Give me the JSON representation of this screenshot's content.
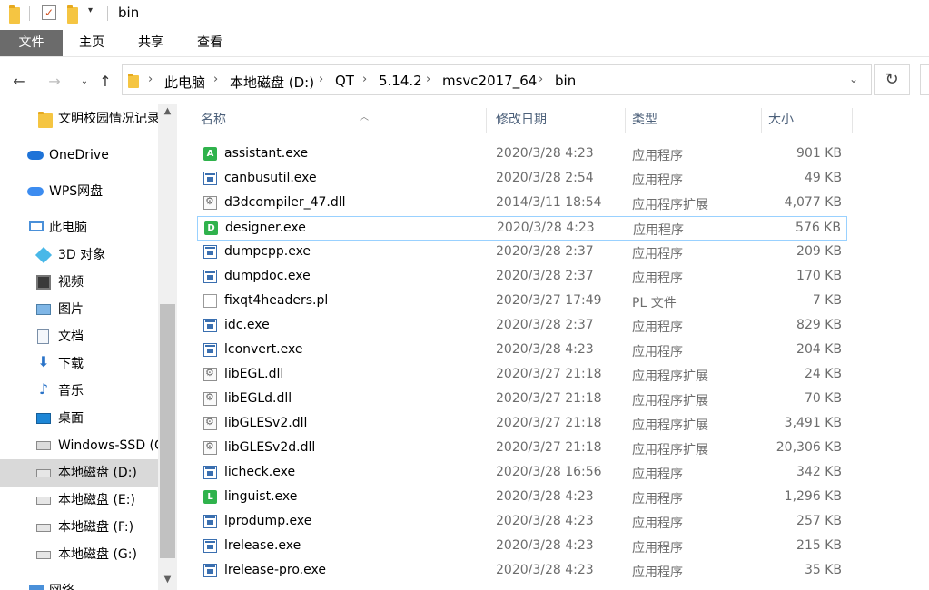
{
  "window": {
    "title": "bin"
  },
  "ribbon": {
    "tabs": [
      "文件",
      "主页",
      "共享",
      "查看"
    ]
  },
  "address": {
    "crumbs": [
      "此电脑",
      "本地磁盘 (D:)",
      "QT",
      "5.14.2",
      "msvc2017_64",
      "bin"
    ]
  },
  "nav": {
    "items": [
      {
        "label": "文明校园情况记录",
        "icon": "folder-icon"
      },
      {
        "label": "OneDrive",
        "icon": "cloud-icon"
      },
      {
        "label": "WPS网盘",
        "icon": "cloud-icon"
      },
      {
        "label": "此电脑",
        "icon": "computer-icon"
      },
      {
        "label": "3D 对象",
        "icon": "cube-icon"
      },
      {
        "label": "视频",
        "icon": "video-icon"
      },
      {
        "label": "图片",
        "icon": "picture-icon"
      },
      {
        "label": "文档",
        "icon": "document-icon"
      },
      {
        "label": "下载",
        "icon": "download-icon"
      },
      {
        "label": "音乐",
        "icon": "music-icon"
      },
      {
        "label": "桌面",
        "icon": "desktop-icon"
      },
      {
        "label": "Windows-SSD (C:)",
        "icon": "drive-icon"
      },
      {
        "label": "本地磁盘 (D:)",
        "icon": "drive-icon"
      },
      {
        "label": "本地磁盘 (E:)",
        "icon": "drive-icon"
      },
      {
        "label": "本地磁盘 (F:)",
        "icon": "drive-icon"
      },
      {
        "label": "本地磁盘 (G:)",
        "icon": "drive-icon"
      },
      {
        "label": "网络",
        "icon": "network-icon"
      }
    ],
    "selected": "本地磁盘 (D:)"
  },
  "columns": {
    "name": "名称",
    "date": "修改日期",
    "type": "类型",
    "size": "大小"
  },
  "files": [
    {
      "name": "assistant.exe",
      "date": "2020/3/28 4:23",
      "type": "应用程序",
      "size": "901 KB",
      "icon": "qt-assistant-icon",
      "badge": "A",
      "color": "#2fb24c"
    },
    {
      "name": "canbusutil.exe",
      "date": "2020/3/28 2:54",
      "type": "应用程序",
      "size": "49 KB",
      "icon": "exe-icon"
    },
    {
      "name": "d3dcompiler_47.dll",
      "date": "2014/3/11 18:54",
      "type": "应用程序扩展",
      "size": "4,077 KB",
      "icon": "dll-icon"
    },
    {
      "name": "designer.exe",
      "date": "2020/3/28 4:23",
      "type": "应用程序",
      "size": "576 KB",
      "icon": "qt-designer-icon",
      "badge": "D",
      "color": "#2fb24c"
    },
    {
      "name": "dumpcpp.exe",
      "date": "2020/3/28 2:37",
      "type": "应用程序",
      "size": "209 KB",
      "icon": "exe-icon"
    },
    {
      "name": "dumpdoc.exe",
      "date": "2020/3/28 2:37",
      "type": "应用程序",
      "size": "170 KB",
      "icon": "exe-icon"
    },
    {
      "name": "fixqt4headers.pl",
      "date": "2020/3/27 17:49",
      "type": "PL 文件",
      "size": "7 KB",
      "icon": "file-icon"
    },
    {
      "name": "idc.exe",
      "date": "2020/3/28 2:37",
      "type": "应用程序",
      "size": "829 KB",
      "icon": "exe-icon"
    },
    {
      "name": "lconvert.exe",
      "date": "2020/3/28 4:23",
      "type": "应用程序",
      "size": "204 KB",
      "icon": "exe-icon"
    },
    {
      "name": "libEGL.dll",
      "date": "2020/3/27 21:18",
      "type": "应用程序扩展",
      "size": "24 KB",
      "icon": "dll-icon"
    },
    {
      "name": "libEGLd.dll",
      "date": "2020/3/27 21:18",
      "type": "应用程序扩展",
      "size": "70 KB",
      "icon": "dll-icon"
    },
    {
      "name": "libGLESv2.dll",
      "date": "2020/3/27 21:18",
      "type": "应用程序扩展",
      "size": "3,491 KB",
      "icon": "dll-icon"
    },
    {
      "name": "libGLESv2d.dll",
      "date": "2020/3/27 21:18",
      "type": "应用程序扩展",
      "size": "20,306 KB",
      "icon": "dll-icon"
    },
    {
      "name": "licheck.exe",
      "date": "2020/3/28 16:56",
      "type": "应用程序",
      "size": "342 KB",
      "icon": "exe-icon"
    },
    {
      "name": "linguist.exe",
      "date": "2020/3/28 4:23",
      "type": "应用程序",
      "size": "1,296 KB",
      "icon": "qt-linguist-icon",
      "badge": "L",
      "color": "#2fb24c"
    },
    {
      "name": "lprodump.exe",
      "date": "2020/3/28 4:23",
      "type": "应用程序",
      "size": "257 KB",
      "icon": "exe-icon"
    },
    {
      "name": "lrelease.exe",
      "date": "2020/3/28 4:23",
      "type": "应用程序",
      "size": "215 KB",
      "icon": "exe-icon"
    },
    {
      "name": "lrelease-pro.exe",
      "date": "2020/3/28 4:23",
      "type": "应用程序",
      "size": "35 KB",
      "icon": "exe-icon"
    }
  ],
  "focused_file": "designer.exe",
  "colors": {
    "file_tab": "#6b6b6b",
    "selection": "#d9d9d9",
    "focus_border": "#99d1ff",
    "header_text": "#4c607a"
  }
}
